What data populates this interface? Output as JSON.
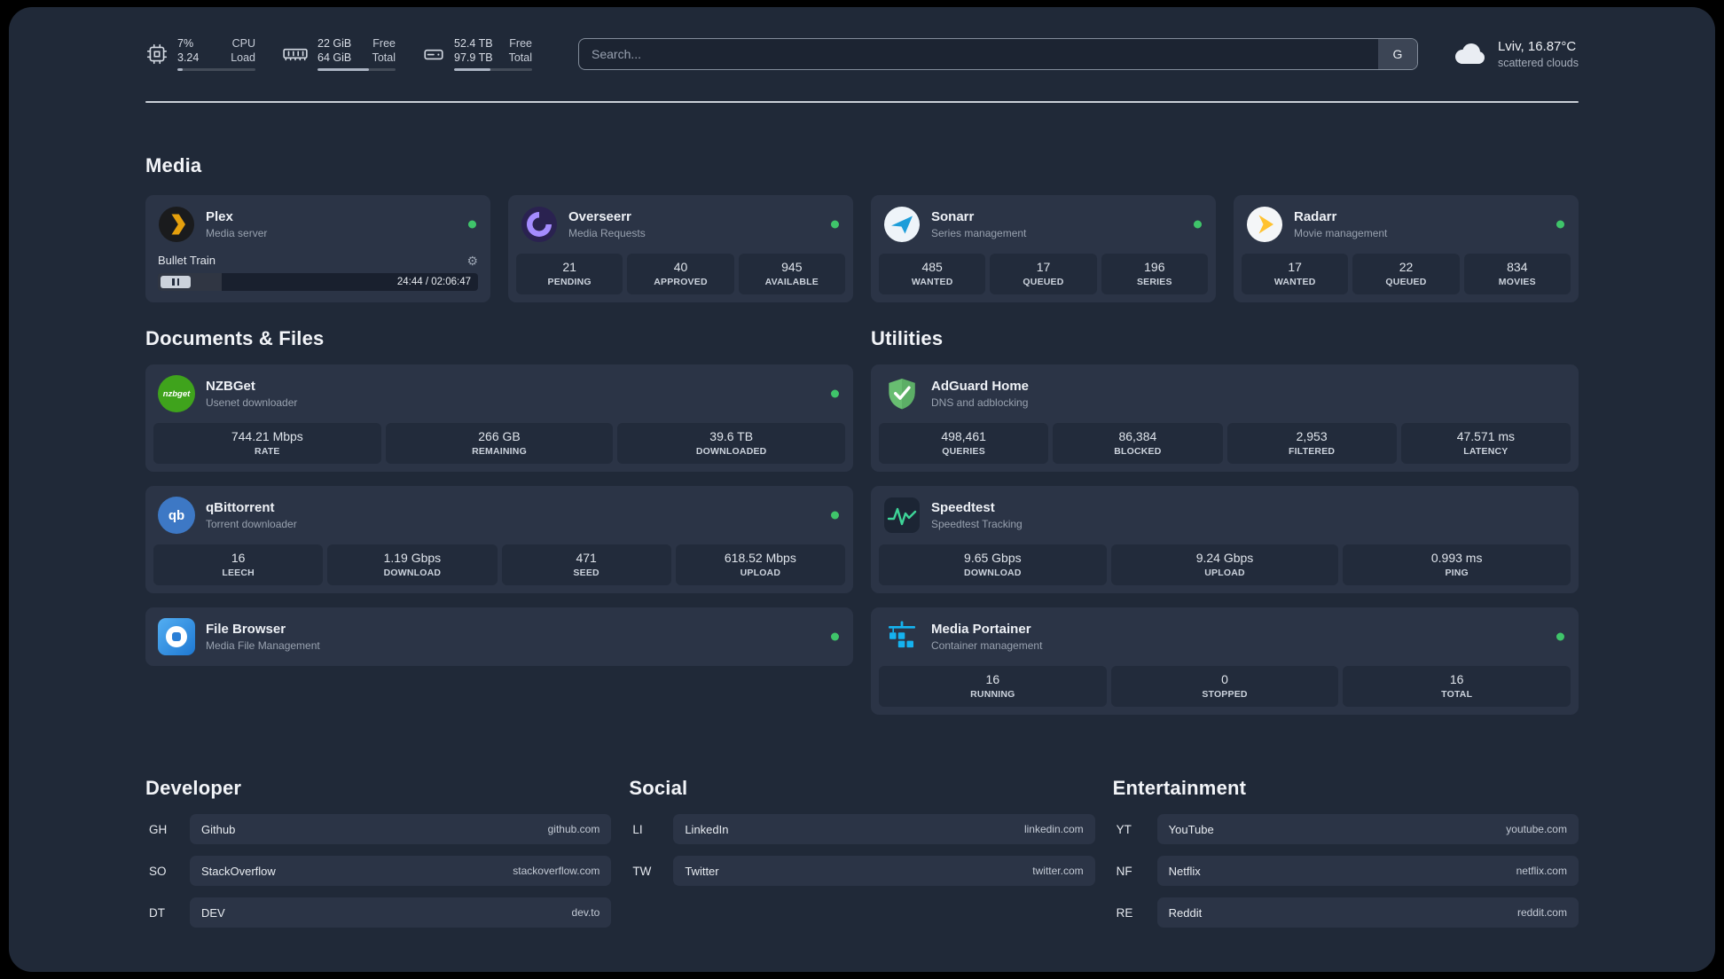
{
  "colors": {
    "status-green": "#3fc46a",
    "divider": "#d9dee6",
    "accent-plex": "#e5a00d"
  },
  "topbar": {
    "resources": [
      {
        "id": "cpu",
        "row1_value": "7%",
        "row1_label": "CPU",
        "row2_value": "3.24",
        "row2_label": "Load",
        "progress": 7
      },
      {
        "id": "memory",
        "row1_value": "22 GiB",
        "row1_label": "Free",
        "row2_value": "64 GiB",
        "row2_label": "Total",
        "progress": 66
      },
      {
        "id": "disk",
        "row1_value": "52.4 TB",
        "row1_label": "Free",
        "row2_value": "97.9 TB",
        "row2_label": "Total",
        "progress": 47
      }
    ],
    "search": {
      "placeholder": "Search...",
      "button_label": "G"
    },
    "weather": {
      "location": "Lviv, 16.87°C",
      "condition": "scattered clouds"
    }
  },
  "sections": {
    "media": {
      "title": "Media",
      "plex": {
        "name": "Plex",
        "subtitle": "Media server",
        "now_playing": "Bullet Train",
        "time": "24:44 / 02:06:47",
        "progress": 20
      },
      "overseerr": {
        "name": "Overseerr",
        "subtitle": "Media Requests",
        "stats": [
          {
            "value": "21",
            "label": "PENDING"
          },
          {
            "value": "40",
            "label": "APPROVED"
          },
          {
            "value": "945",
            "label": "AVAILABLE"
          }
        ]
      },
      "sonarr": {
        "name": "Sonarr",
        "subtitle": "Series management",
        "stats": [
          {
            "value": "485",
            "label": "WANTED"
          },
          {
            "value": "17",
            "label": "QUEUED"
          },
          {
            "value": "196",
            "label": "SERIES"
          }
        ]
      },
      "radarr": {
        "name": "Radarr",
        "subtitle": "Movie management",
        "stats": [
          {
            "value": "17",
            "label": "WANTED"
          },
          {
            "value": "22",
            "label": "QUEUED"
          },
          {
            "value": "834",
            "label": "MOVIES"
          }
        ]
      }
    },
    "documents": {
      "title": "Documents & Files",
      "nzbget": {
        "name": "NZBGet",
        "subtitle": "Usenet downloader",
        "icon_text": "nzbget",
        "stats": [
          {
            "value": "744.21 Mbps",
            "label": "RATE"
          },
          {
            "value": "266 GB",
            "label": "REMAINING"
          },
          {
            "value": "39.6 TB",
            "label": "DOWNLOADED"
          }
        ]
      },
      "qbittorrent": {
        "name": "qBittorrent",
        "subtitle": "Torrent downloader",
        "icon_text": "qb",
        "stats": [
          {
            "value": "16",
            "label": "LEECH"
          },
          {
            "value": "1.19 Gbps",
            "label": "DOWNLOAD"
          },
          {
            "value": "471",
            "label": "SEED"
          },
          {
            "value": "618.52 Mbps",
            "label": "UPLOAD"
          }
        ]
      },
      "filebrowser": {
        "name": "File Browser",
        "subtitle": "Media File Management"
      }
    },
    "utilities": {
      "title": "Utilities",
      "adguard": {
        "name": "AdGuard Home",
        "subtitle": "DNS and adblocking",
        "stats": [
          {
            "value": "498,461",
            "label": "QUERIES"
          },
          {
            "value": "86,384",
            "label": "BLOCKED"
          },
          {
            "value": "2,953",
            "label": "FILTERED"
          },
          {
            "value": "47.571 ms",
            "label": "LATENCY"
          }
        ]
      },
      "speedtest": {
        "name": "Speedtest",
        "subtitle": "Speedtest Tracking",
        "stats": [
          {
            "value": "9.65 Gbps",
            "label": "DOWNLOAD"
          },
          {
            "value": "9.24 Gbps",
            "label": "UPLOAD"
          },
          {
            "value": "0.993 ms",
            "label": "PING"
          }
        ]
      },
      "portainer": {
        "name": "Media Portainer",
        "subtitle": "Container management",
        "stats": [
          {
            "value": "16",
            "label": "RUNNING"
          },
          {
            "value": "0",
            "label": "STOPPED"
          },
          {
            "value": "16",
            "label": "TOTAL"
          }
        ]
      }
    }
  },
  "bookmarks": {
    "developer": {
      "title": "Developer",
      "items": [
        {
          "abbr": "GH",
          "name": "Github",
          "url": "github.com"
        },
        {
          "abbr": "SO",
          "name": "StackOverflow",
          "url": "stackoverflow.com"
        },
        {
          "abbr": "DT",
          "name": "DEV",
          "url": "dev.to"
        }
      ]
    },
    "social": {
      "title": "Social",
      "items": [
        {
          "abbr": "LI",
          "name": "LinkedIn",
          "url": "linkedin.com"
        },
        {
          "abbr": "TW",
          "name": "Twitter",
          "url": "twitter.com"
        }
      ]
    },
    "entertainment": {
      "title": "Entertainment",
      "items": [
        {
          "abbr": "YT",
          "name": "YouTube",
          "url": "youtube.com"
        },
        {
          "abbr": "NF",
          "name": "Netflix",
          "url": "netflix.com"
        },
        {
          "abbr": "RE",
          "name": "Reddit",
          "url": "reddit.com"
        }
      ]
    }
  }
}
